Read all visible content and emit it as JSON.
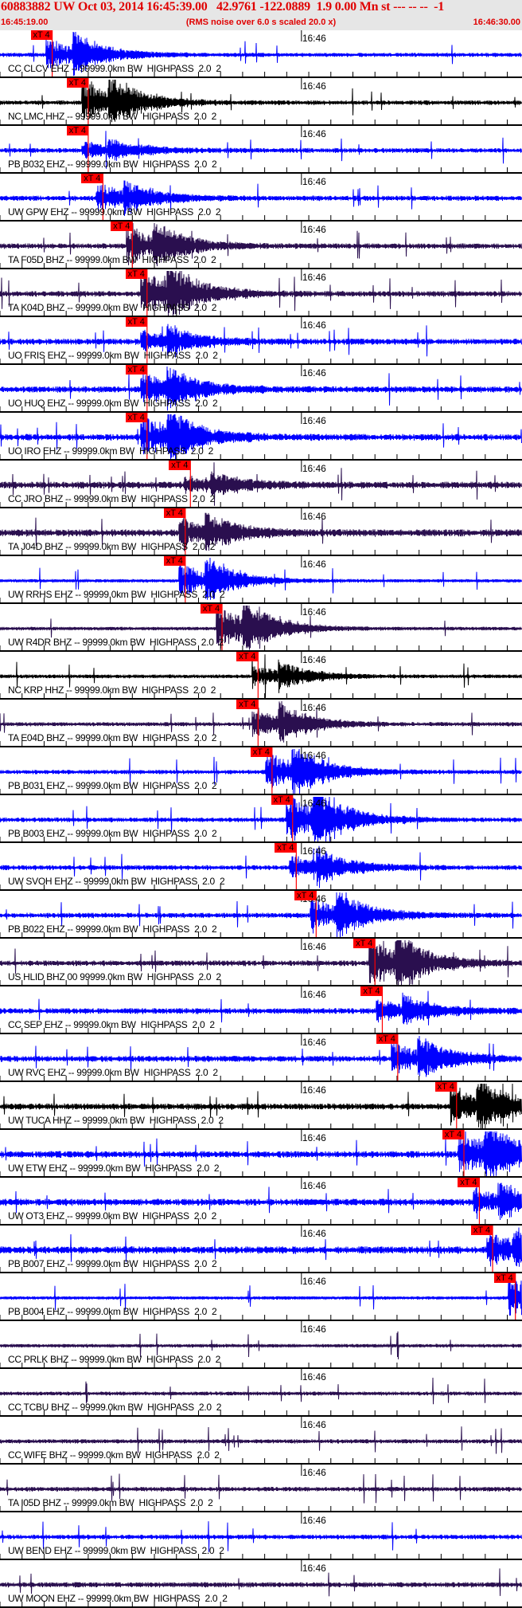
{
  "header": {
    "title": "60883882 UW Oct 03, 2014 16:45:39.00   42.9761 -122.0889  1.9 0.00 Mn st --- -- --  -1",
    "start_time": "16:45:19.00",
    "end_time": "16:46:30.00",
    "note": "(RMS noise over 6.0 s scaled 20.0 x)"
  },
  "minute_label": "16:46",
  "pick_label": "xT 4",
  "colors": {
    "blue": "#0000ff",
    "black": "#000000",
    "purple": "#2a0f4f",
    "pick": "#ff0000",
    "header_text": "#e00000"
  },
  "traces": [
    {
      "label": "CC CLCV EHZ -- 99999.0km BW  HIGHPASS  2.0  2",
      "color": "blue",
      "pick": "16:45:26.1"
    },
    {
      "label": "NC LMC HHZ -- 99999.0km BW  HIGHPASS  2.0  2",
      "color": "black",
      "pick": "16:45:31.0"
    },
    {
      "label": "PB B032 EHZ -- 99999.0km BW  HIGHPASS  2.0  2",
      "color": "blue",
      "pick": "16:45:31.0"
    },
    {
      "label": "UW GPW EHZ -- 99999.0km BW  HIGHPASS  2.0  2",
      "color": "blue",
      "pick": "16:45:33.0"
    },
    {
      "label": "TA F05D BHZ -- 99999.0km BW  HIGHPASS  2.0  2",
      "color": "purple",
      "pick": "16:45:37.0"
    },
    {
      "label": "TA K04D BHZ -- 99999.0km BW  HIGHPASS  2.0  2",
      "color": "purple",
      "pick": "16:45:39.0"
    },
    {
      "label": "UO FRIS EHZ -- 99999.0km BW  HIGHPASS  2.0  2",
      "color": "blue",
      "pick": "16:45:39.0"
    },
    {
      "label": "UO HUQ EHZ -- 99999.0km BW  HIGHPASS  2.0  2",
      "color": "blue",
      "pick": "16:45:39.0"
    },
    {
      "label": "UO IRO EHZ -- 99999.0km BW  HIGHPASS  2.0  2",
      "color": "blue",
      "pick": "16:45:39.0"
    },
    {
      "label": "CC JRO BHZ -- 99999.0km BW  HIGHPASS  2.0  2",
      "color": "purple",
      "pick": "16:45:44.9"
    },
    {
      "label": "TA J04D BHZ -- 99999.0km BW  HIGHPASS  2.0  2",
      "color": "purple",
      "pick": "16:45:44.2"
    },
    {
      "label": "UW RRHS EHZ -- 99999.0km BW  HIGHPASS  2.0  2",
      "color": "blue",
      "pick": "16:45:44.2"
    },
    {
      "label": "UW R4DR BHZ -- 99999.0km BW  HIGHPASS  2.0  2",
      "color": "purple",
      "pick": "16:45:49.2"
    },
    {
      "label": "NC KRP HHZ -- 99999.0km BW  HIGHPASS  2.0  2",
      "color": "black",
      "pick": "16:45:54.1"
    },
    {
      "label": "TA E04D BHZ -- 99999.0km BW  HIGHPASS  2.0  2",
      "color": "purple",
      "pick": "16:45:54.1"
    },
    {
      "label": "PB B031 EHZ -- 99999.0km BW  HIGHPASS  2.0  2",
      "color": "blue",
      "pick": "16:45:56.0"
    },
    {
      "label": "PB B003 EHZ -- 99999.0km BW  HIGHPASS  2.0  2",
      "color": "blue",
      "pick": "16:45:58.8"
    },
    {
      "label": "UW SVOH EHZ -- 99999.0km BW  HIGHPASS  2.0  2",
      "color": "blue",
      "pick": "16:45:59.3"
    },
    {
      "label": "PB B022 EHZ -- 99999.0km BW  HIGHPASS  2.0  2",
      "color": "blue",
      "pick": "16:46:02.0"
    },
    {
      "label": "US HLID BHZ 00 99999.0km BW  HIGHPASS  2.0  2",
      "color": "purple",
      "pick": "16:46:10.0"
    },
    {
      "label": "CC SEP EHZ -- 99999.0km BW  HIGHPASS  2.0  2",
      "color": "blue",
      "pick": "16:46:11.0"
    },
    {
      "label": "UW RVC EHZ -- 99999.0km BW  HIGHPASS  2.0  2",
      "color": "blue",
      "pick": "16:46:13.1"
    },
    {
      "label": "UW TUCA HHZ -- 99999.0km BW  HIGHPASS  2.0  2",
      "color": "black",
      "pick": "16:46:21.1"
    },
    {
      "label": "UW ETW EHZ -- 99999.0km BW  HIGHPASS  2.0  2",
      "color": "blue",
      "pick": "16:46:22.1"
    },
    {
      "label": "UW OT3 EHZ -- 99999.0km BW  HIGHPASS  2.0  2",
      "color": "blue",
      "pick": "16:46:24.2"
    },
    {
      "label": "PB B007 EHZ -- 99999.0km BW  HIGHPASS  2.0  2",
      "color": "blue",
      "pick": "16:46:26.0"
    },
    {
      "label": "PB B004 EHZ -- 99999.0km BW  HIGHPASS  2.0  2",
      "color": "blue",
      "pick": "16:46:29.1"
    },
    {
      "label": "CC PRLK BHZ -- 99999.0km BW  HIGHPASS  2.0  2",
      "color": "purple",
      "pick": null
    },
    {
      "label": "CC TCBU BHZ -- 99999.0km BW  HIGHPASS  2.0  2",
      "color": "purple",
      "pick": null
    },
    {
      "label": "CC WIFE BHZ -- 99999.0km BW  HIGHPASS  2.0  2",
      "color": "purple",
      "pick": null
    },
    {
      "label": "TA I05D BHZ -- 99999.0km BW  HIGHPASS  2.0  2",
      "color": "purple",
      "pick": null
    },
    {
      "label": "UW BEND EHZ -- 99999.0km BW  HIGHPASS  2.0  2",
      "color": "blue",
      "pick": null
    },
    {
      "label": "UW MOON EHZ -- 99999.0km BW  HIGHPASS  2.0  2",
      "color": "purple",
      "pick": null
    }
  ]
}
